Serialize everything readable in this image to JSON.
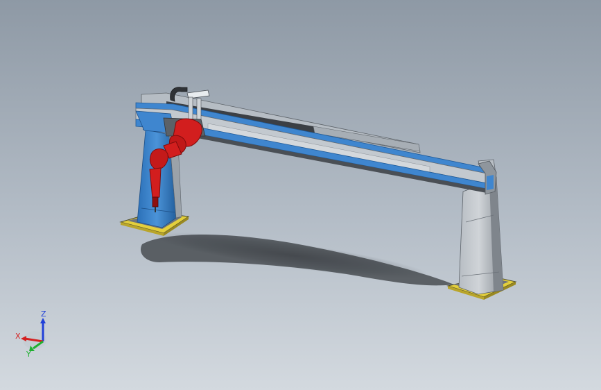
{
  "colors": {
    "background_top": "#8d98a4",
    "background_bottom": "#cfd6dd",
    "steel_blue": "#3f86cf",
    "steel_blue_dark": "#1f5a98",
    "rail_grey": "#a9b1b9",
    "rail_dark": "#3b3f44",
    "column_grey": "#9aa1a8",
    "column_grey_light": "#c2c7cc",
    "robot_red": "#d21e1e",
    "robot_red_dark": "#7e0c0c",
    "base_plate_yellow": "#e3cf3c",
    "shadow": "#2e3136"
  },
  "model": {
    "icons": {
      "robot": "robot-arm-icon",
      "gantry": "gantry-beam-icon"
    }
  },
  "triad": {
    "x_label": "X",
    "y_label": "Y",
    "z_label": "Z",
    "x_color": "#d42020",
    "y_color": "#20b030",
    "z_color": "#2040d8"
  }
}
